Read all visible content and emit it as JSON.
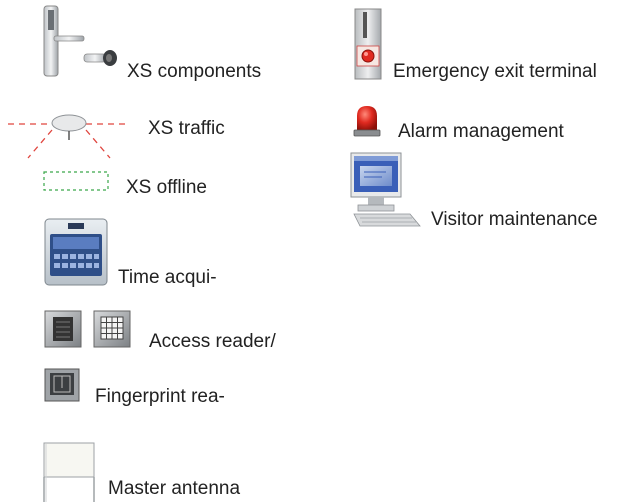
{
  "legend": {
    "left": [
      {
        "key": "xs-components",
        "label": "XS components",
        "icon": "door-lock-icon"
      },
      {
        "key": "xs-traffic",
        "label": "XS traffic",
        "icon": "antenna-icon"
      },
      {
        "key": "xs-offline",
        "label": "XS offline",
        "icon": "dashed-box-icon"
      },
      {
        "key": "time-acquisition",
        "label": "Time acqui-",
        "icon": "time-terminal-icon"
      },
      {
        "key": "access-reader",
        "label": "Access reader/",
        "icon": "access-reader-icon"
      },
      {
        "key": "fingerprint-reader",
        "label": "Fingerprint rea-",
        "icon": "fingerprint-reader-icon"
      },
      {
        "key": "master-antenna",
        "label": "Master antenna",
        "icon": "master-antenna-icon"
      }
    ],
    "right": [
      {
        "key": "emergency-exit",
        "label": "Emergency exit terminal",
        "icon": "emergency-terminal-icon"
      },
      {
        "key": "alarm-management",
        "label": "Alarm management",
        "icon": "alarm-light-icon"
      },
      {
        "key": "visitor-maintenance",
        "label": "Visitor maintenance",
        "icon": "computer-icon"
      }
    ]
  },
  "colors": {
    "traffic_red": "#e0463f",
    "offline_green": "#3aa64a",
    "alarm_red": "#e02a20",
    "screen_blue": "#3a5fb8"
  }
}
